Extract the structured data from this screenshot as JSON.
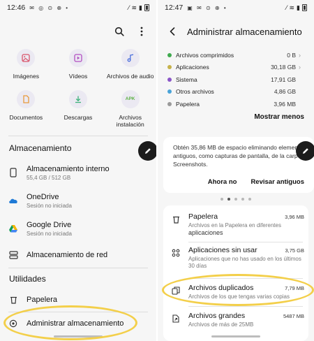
{
  "left": {
    "status": {
      "time": "12:46",
      "glyphs": "✉ ◎ ⊙ ⊕ •"
    },
    "categories": [
      {
        "label": "Imágenes",
        "icon": "image-icon",
        "color": "#d9536a"
      },
      {
        "label": "Vídeos",
        "icon": "video-icon",
        "color": "#b24fc1"
      },
      {
        "label": "Archivos de audio",
        "icon": "music-icon",
        "color": "#4a6fdc"
      },
      {
        "label": "Documentos",
        "icon": "document-icon",
        "color": "#e89a3c"
      },
      {
        "label": "Descargas",
        "icon": "download-icon",
        "color": "#3db27a"
      },
      {
        "label": "Archivos instalación",
        "icon": "apk-icon",
        "badge": "APK",
        "color": "#5bb043"
      }
    ],
    "storage_title": "Almacenamiento",
    "storage_items": [
      {
        "title": "Almacenamiento interno",
        "sub": "55,4 GB / 512 GB"
      },
      {
        "title": "OneDrive",
        "sub": "Sesión no iniciada"
      },
      {
        "title": "Google Drive",
        "sub": "Sesión no iniciada"
      },
      {
        "title": "Almacenamiento de red",
        "sub": ""
      }
    ],
    "utilities_title": "Utilidades",
    "utilities": [
      {
        "title": "Papelera"
      },
      {
        "title": "Administrar almacenamiento"
      }
    ]
  },
  "right": {
    "status": {
      "time": "12:47",
      "glyphs": "▣ ✉ ⊙ ⊕ •"
    },
    "title": "Administrar almacenamiento",
    "legend": [
      {
        "label": "Archivos comprimidos",
        "size": "0 B",
        "color": "#3faa4e",
        "chevron": true
      },
      {
        "label": "Aplicaciones",
        "size": "30,18 GB",
        "color": "#c6b24a",
        "chevron": true
      },
      {
        "label": "Sistema",
        "size": "17,91 GB",
        "color": "#8a55c8",
        "chevron": false
      },
      {
        "label": "Otros archivos",
        "size": "4,86 GB",
        "color": "#4aa3d8",
        "chevron": false
      },
      {
        "label": "Papelera",
        "size": "3,96 MB",
        "color": "#9a9a9a",
        "chevron": false
      }
    ],
    "show_less": "Mostrar menos",
    "card": {
      "line1": "Obtén 35,86 MB de espacio eliminando elemento",
      "line2": "antiguos, como capturas de pantalla, de la carpeta",
      "line3": "Screenshots.",
      "action1": "Ahora no",
      "action2": "Revisar antiguos"
    },
    "list": [
      {
        "title": "Papelera",
        "size": "3,96 MB",
        "sub1": "Archivos en la Papelera en diferentes",
        "sub2": "aplicaciones",
        "sub3": ""
      },
      {
        "title": "Aplicaciones sin usar",
        "size": "3,75 GB",
        "sub1": "Aplicaciones que no has usado en los últimos",
        "sub2": "30 días",
        "sub3": ""
      },
      {
        "title": "Archivos duplicados",
        "size": "7,79 MB",
        "sub1": "Archivos de los que tengas varias copias",
        "sub2": "",
        "sub3": ""
      },
      {
        "title": "Archivos grandes",
        "size": "5487 MB",
        "sub1": "Archivos de más de 25MB",
        "sub2": "",
        "sub3": ""
      }
    ]
  }
}
